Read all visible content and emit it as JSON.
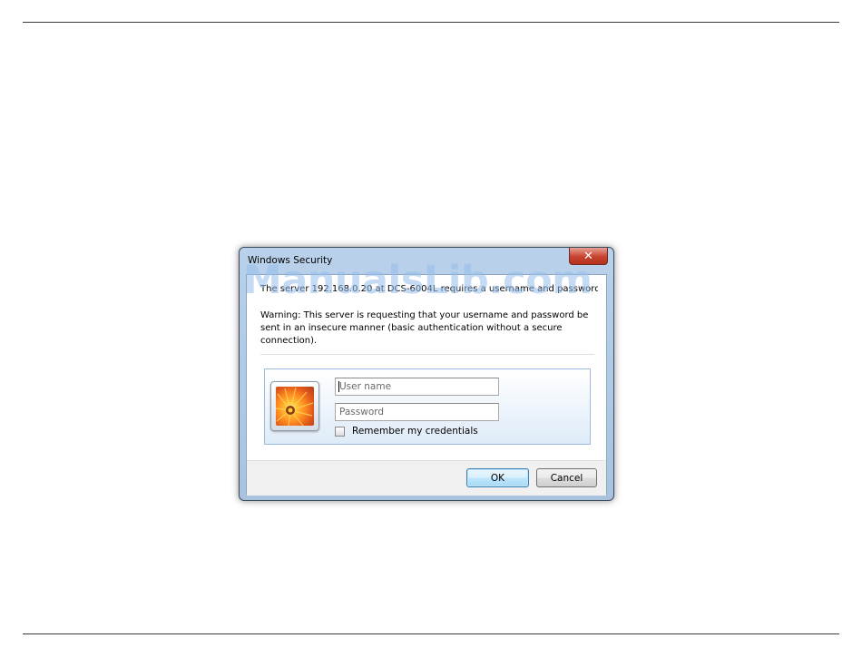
{
  "dialog": {
    "title": "Windows Security",
    "close_glyph": "✕",
    "message": "The server 192.168.0.20 at DCS-6004L requires a username and password.",
    "warning": "Warning: This server is requesting that your username and password be sent in an insecure manner (basic authentication without a secure connection).",
    "username_placeholder": "User name",
    "password_placeholder": "Password",
    "remember_label": "Remember my credentials",
    "ok_label": "OK",
    "cancel_label": "Cancel"
  },
  "watermark": "ManualsLib.com",
  "colors": {
    "close_button": "#c7432f",
    "ok_button_border": "#3c7fb1",
    "credentials_panel_border": "#9bbbe0"
  }
}
